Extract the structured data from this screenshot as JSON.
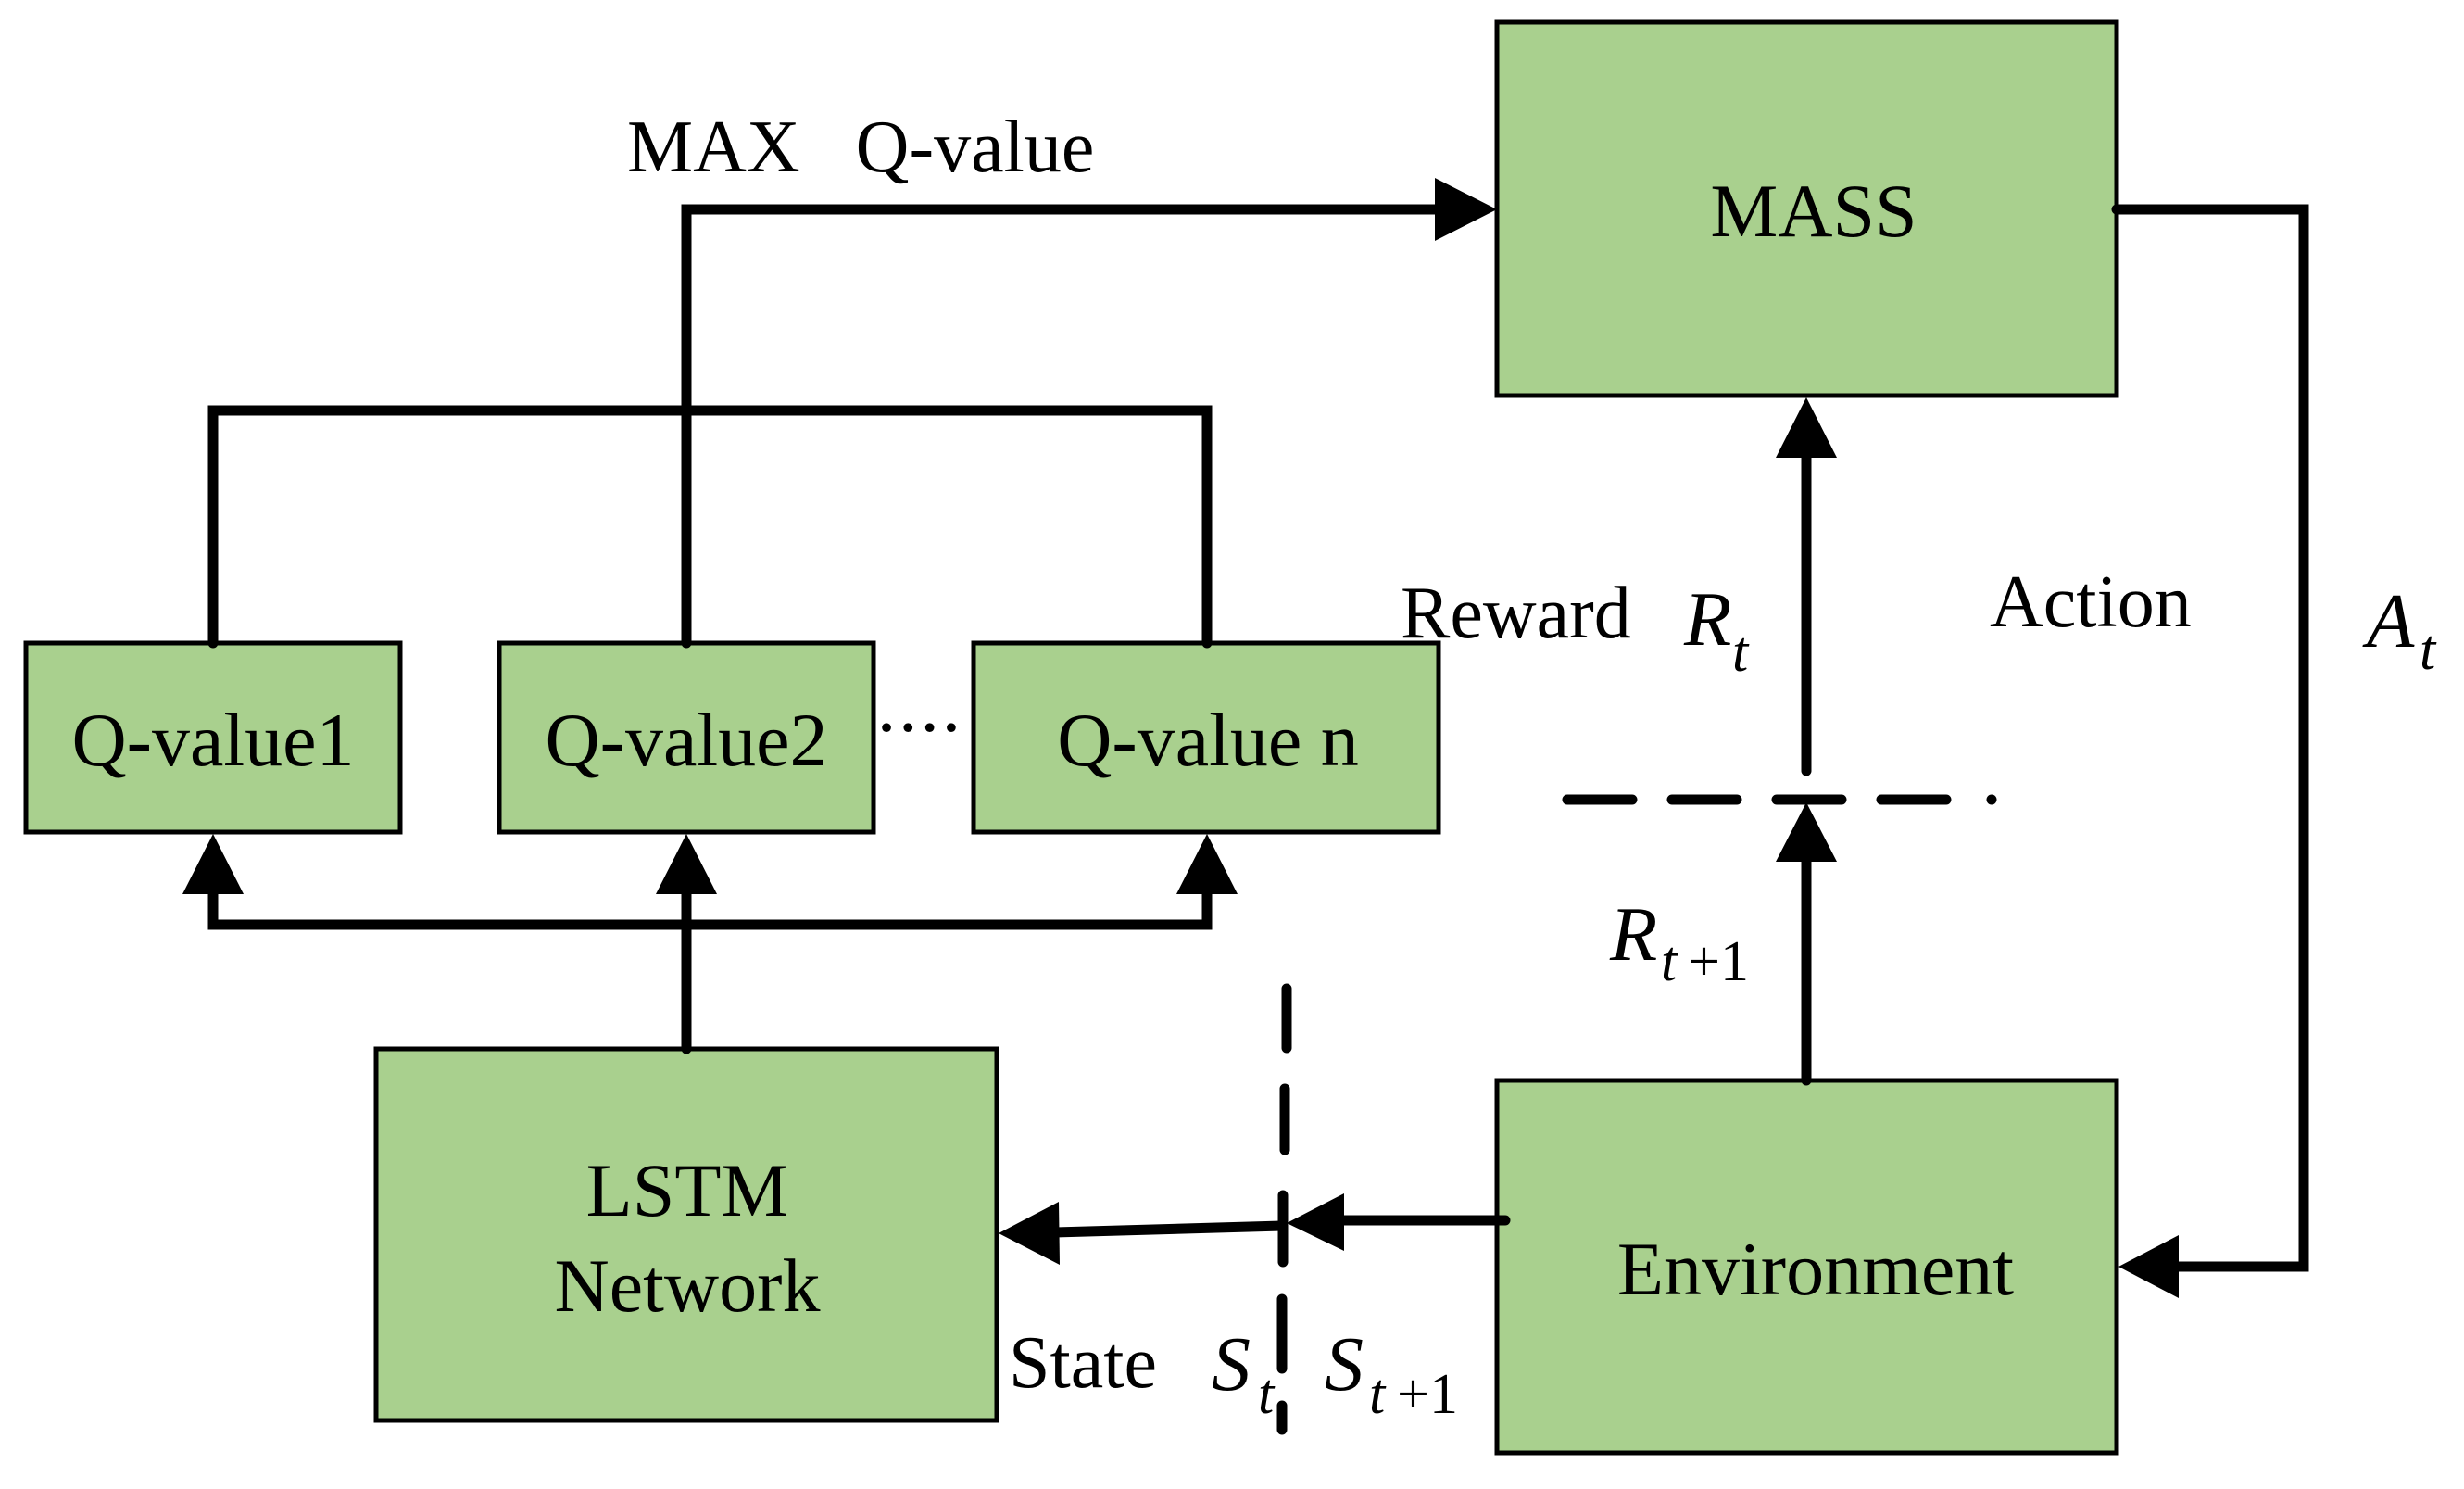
{
  "diagram": {
    "colors": {
      "box_fill": "#A9D08E",
      "line": "#000000",
      "background": "#FFFFFF"
    },
    "nodes": {
      "mass": {
        "label": "MASS"
      },
      "q1": {
        "label": "Q-value1"
      },
      "q2": {
        "label": "Q-value2"
      },
      "qn": {
        "label": "Q-value n"
      },
      "lstm": {
        "line1": "LSTM",
        "line2": "Network"
      },
      "env": {
        "label": "Environment"
      }
    },
    "ellipsis": "····",
    "labels": {
      "max_q": "MAX   Q-value",
      "reward": "Reward",
      "reward_sym": "R",
      "reward_sub": "t",
      "reward_next_sym": "R",
      "reward_next_sub": "t",
      "reward_next_sub2": "+1",
      "action": "Action",
      "action_sym": "A",
      "action_sub": "t",
      "state": "State",
      "state_sym": "S",
      "state_sub": "t",
      "state_next_sym": "S",
      "state_next_sub": "t",
      "state_next_sub2": "+1"
    }
  }
}
